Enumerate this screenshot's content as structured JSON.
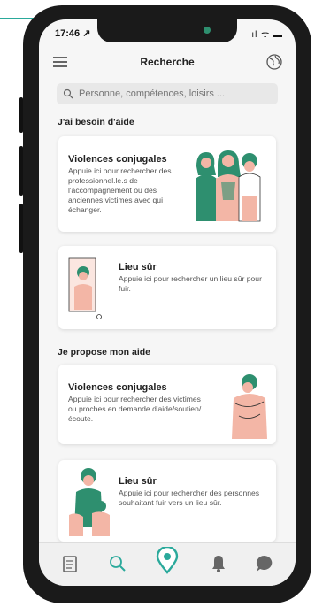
{
  "status": {
    "time": "17:46 ↗",
    "icons": "ıl ᯤ ▬"
  },
  "header": {
    "title": "Recherche",
    "menu_icon": "hamburger-menu-icon",
    "language_icon": "globe-icon"
  },
  "search": {
    "placeholder": "Personne, compétences, loisirs ..."
  },
  "sections": [
    {
      "title": "J'ai besoin d'aide",
      "cards": [
        {
          "title": "Violences conjugales",
          "text": "Appuie ici pour rechercher des professionnel.le.s de l'accompagnement ou des anciennes victimes avec qui échanger."
        },
        {
          "title": "Lieu sûr",
          "text": "Appuie ici pour rechercher un lieu sûr pour fuir."
        }
      ]
    },
    {
      "title": "Je propose mon aide",
      "cards": [
        {
          "title": "Violences conjugales",
          "text": "Appuie ici pour rechercher des victimes ou proches en demande d'aide/soutien/écoute."
        },
        {
          "title": "Lieu sûr",
          "text": "Appuie ici pour rechercher des personnes souhaitant fuir vers un lieu sûr."
        }
      ]
    }
  ],
  "tabbar": {
    "items": [
      "journal-icon",
      "search-icon",
      "location-pin-icon",
      "bell-icon",
      "chat-icon"
    ],
    "active_color": "#2aa99b"
  },
  "colors": {
    "accent": "#2aa99b",
    "illustration_skin": "#f3b6a6",
    "illustration_green": "#2e8f6f"
  }
}
